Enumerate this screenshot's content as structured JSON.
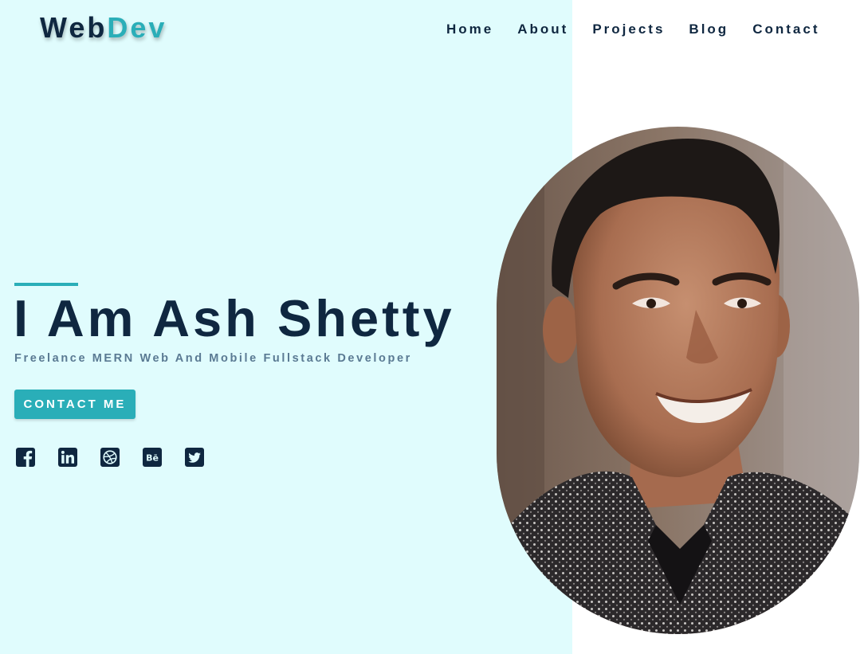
{
  "header": {
    "logo_part1": "Web",
    "logo_part2": "Dev",
    "nav": [
      "Home",
      "About",
      "Projects",
      "Blog",
      "Contact"
    ]
  },
  "hero": {
    "title": "I Am Ash Shetty",
    "subtitle": "Freelance MERN Web And Mobile Fullstack Developer",
    "cta_label": "CONTACT ME"
  },
  "socials": [
    "facebook-icon",
    "linkedin-icon",
    "dribbble-icon",
    "behance-icon",
    "twitter-icon"
  ],
  "colors": {
    "panel_bg": "#e0fcfd",
    "accent": "#2aaeb8",
    "navy": "#0f2740",
    "subtitle": "#5a7a93"
  }
}
